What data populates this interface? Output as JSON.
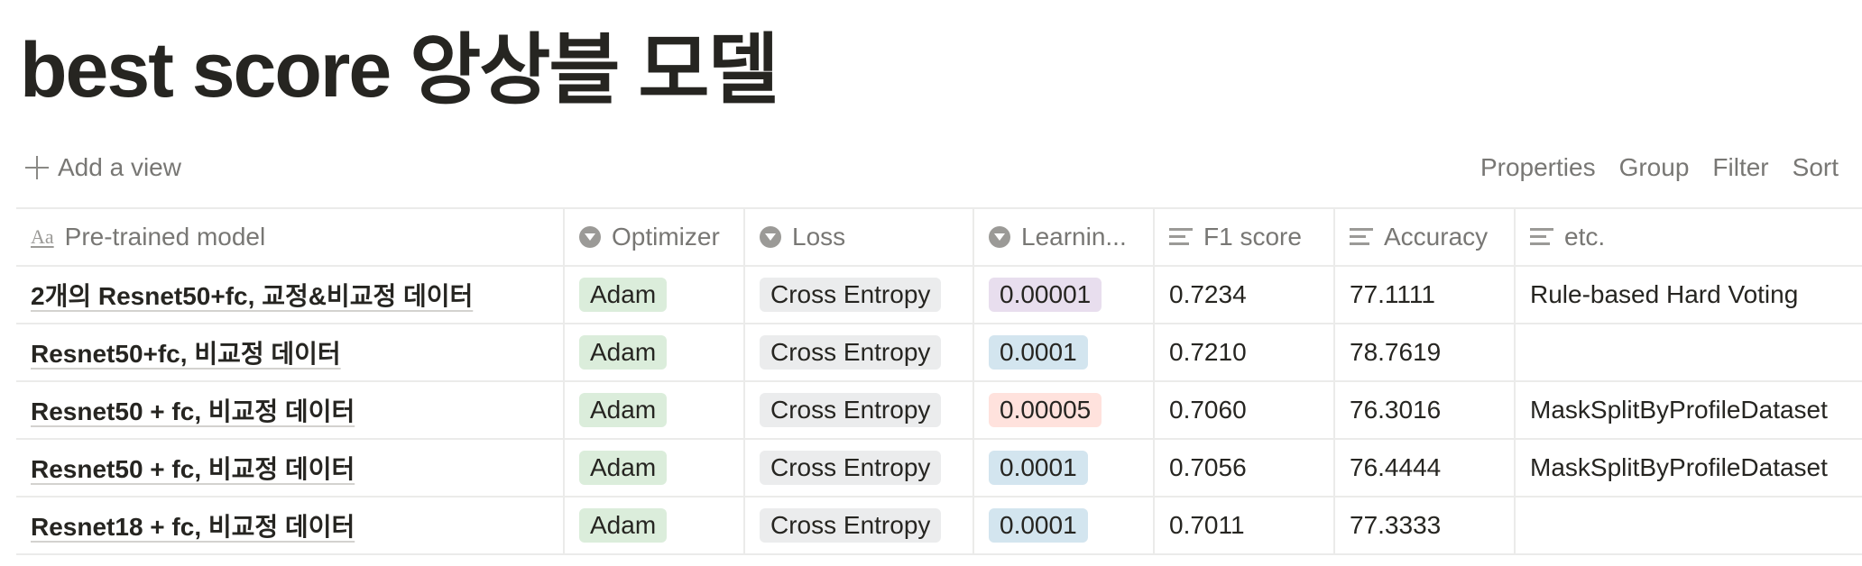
{
  "page": {
    "title": "best score 앙상블 모델"
  },
  "view_bar": {
    "add_view_label": "Add a view",
    "actions": [
      "Properties",
      "Group",
      "Filter",
      "Sort"
    ]
  },
  "table": {
    "columns": [
      {
        "label": "Pre-trained model",
        "icon": "text-property-icon"
      },
      {
        "label": "Optimizer",
        "icon": "select-property-icon"
      },
      {
        "label": "Loss",
        "icon": "select-property-icon"
      },
      {
        "label": "Learnin...",
        "icon": "select-property-icon"
      },
      {
        "label": "F1 score",
        "icon": "text-lines-icon"
      },
      {
        "label": "Accuracy",
        "icon": "text-lines-icon"
      },
      {
        "label": "etc.",
        "icon": "text-lines-icon"
      }
    ],
    "rows": [
      {
        "model": "2개의 Resnet50+fc, 교정&비교정 데이터",
        "optimizer": "Adam",
        "loss": "Cross Entropy",
        "learning_rate": "0.00001",
        "lr_color": "#e8deee",
        "f1": "0.7234",
        "accuracy": "77.1111",
        "etc": "Rule-based Hard Voting"
      },
      {
        "model": "Resnet50+fc, 비교정 데이터",
        "optimizer": "Adam",
        "loss": "Cross Entropy",
        "learning_rate": "0.0001",
        "lr_color": "#d3e5ef",
        "f1": "0.7210",
        "accuracy": "78.7619",
        "etc": ""
      },
      {
        "model": "Resnet50 + fc, 비교정 데이터",
        "optimizer": "Adam",
        "loss": "Cross Entropy",
        "learning_rate": "0.00005",
        "lr_color": "#ffe2dd",
        "f1": "0.7060",
        "accuracy": "76.3016",
        "etc": "MaskSplitByProfileDataset"
      },
      {
        "model": "Resnet50 + fc, 비교정 데이터",
        "optimizer": "Adam",
        "loss": "Cross Entropy",
        "learning_rate": "0.0001",
        "lr_color": "#d3e5ef",
        "f1": "0.7056",
        "accuracy": "76.4444",
        "etc": "MaskSplitByProfileDataset"
      },
      {
        "model": "Resnet18 + fc, 비교정 데이터",
        "optimizer": "Adam",
        "loss": "Cross Entropy",
        "learning_rate": "0.0001",
        "lr_color": "#d3e5ef",
        "f1": "0.7011",
        "accuracy": "77.3333",
        "etc": ""
      }
    ]
  },
  "colors": {
    "optimizer_tag": "#dbeddb",
    "loss_tag": "#ebeced"
  }
}
